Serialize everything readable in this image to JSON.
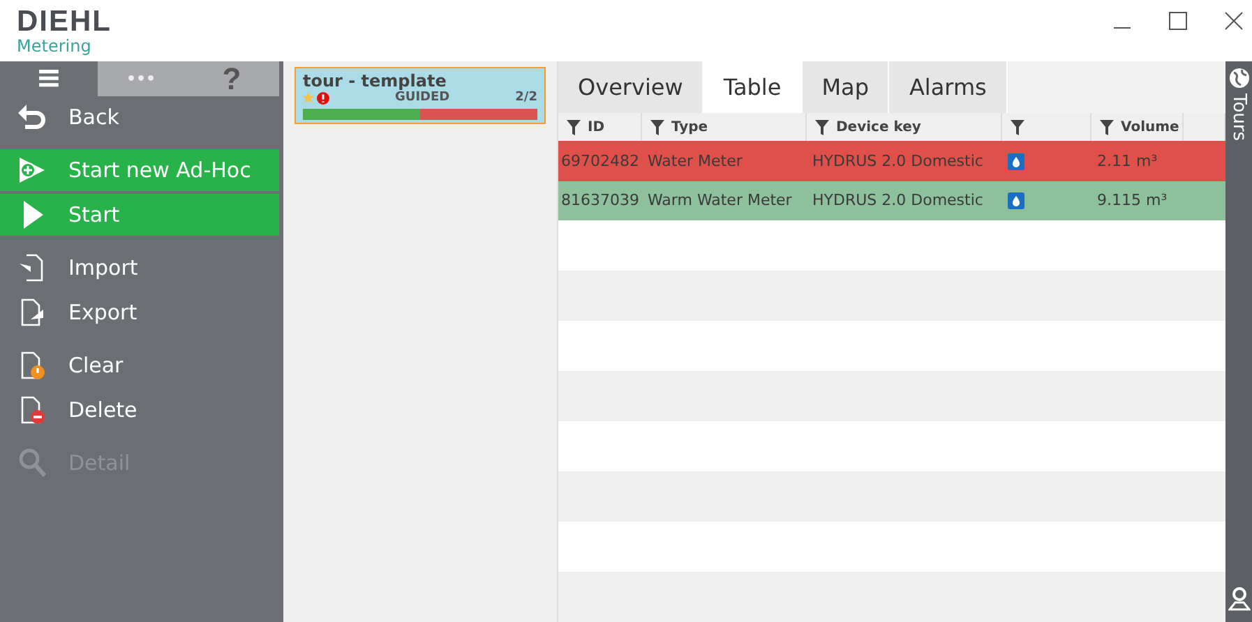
{
  "window": {
    "logo": "DIEHL",
    "logo_sub": "Metering"
  },
  "toolbar": {
    "menu": "≡",
    "more": "•••",
    "help": "?"
  },
  "sidebar": {
    "items": [
      {
        "label": "Back",
        "kind": "plain",
        "disabled": false
      },
      {
        "label": "Start new Ad-Hoc",
        "kind": "primary",
        "disabled": false
      },
      {
        "label": "Start",
        "kind": "primary",
        "disabled": false
      },
      {
        "label": "Import",
        "kind": "plain",
        "disabled": false
      },
      {
        "label": "Export",
        "kind": "plain",
        "disabled": false
      },
      {
        "label": "Clear",
        "kind": "plain",
        "disabled": false
      },
      {
        "label": "Delete",
        "kind": "plain",
        "disabled": false
      },
      {
        "label": "Detail",
        "kind": "plain",
        "disabled": true
      }
    ]
  },
  "tours": [
    {
      "name": "tour - template",
      "mode": "GUIDED",
      "count": "2/2",
      "selected": true,
      "favorite": true,
      "alert": true,
      "level": 0.5
    }
  ],
  "tabs": [
    {
      "label": "Overview",
      "selected": false
    },
    {
      "label": "Table",
      "selected": true
    },
    {
      "label": "Map",
      "selected": false
    },
    {
      "label": "Alarms",
      "selected": false
    }
  ],
  "table": {
    "columns": [
      "ID",
      "Type",
      "Device key",
      "",
      "Volume"
    ],
    "rows": [
      {
        "cells": [
          "69702482",
          "Water Meter",
          "HYDRUS 2.0 Domestic",
          "",
          "2.11 m³"
        ],
        "color": "#e0504a"
      },
      {
        "cells": [
          "81637039",
          "Warm Water Meter",
          "HYDRUS 2.0 Domestic",
          "",
          "9.115 m³"
        ],
        "color": "#8fc09c"
      }
    ]
  },
  "side_strip": {
    "label": "Tours"
  }
}
